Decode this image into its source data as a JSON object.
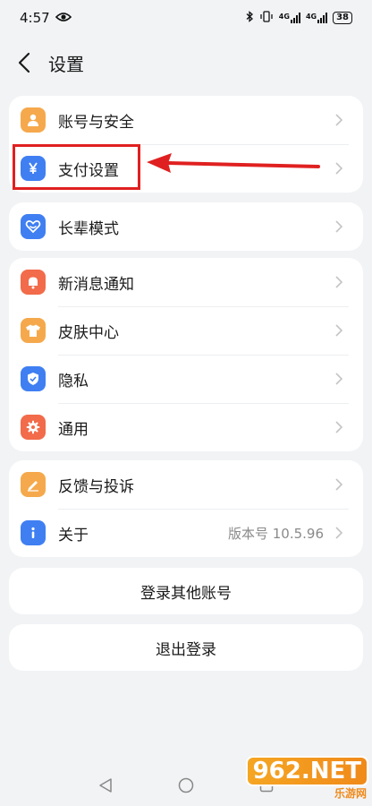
{
  "status": {
    "time": "4:57",
    "battery": "38",
    "net1": "4G",
    "net2": "4G"
  },
  "header": {
    "title": "设置"
  },
  "groups": {
    "g1": [
      {
        "label": "账号与安全"
      },
      {
        "label": "支付设置"
      }
    ],
    "g2": [
      {
        "label": "长辈模式"
      }
    ],
    "g3": [
      {
        "label": "新消息通知"
      },
      {
        "label": "皮肤中心"
      },
      {
        "label": "隐私"
      },
      {
        "label": "通用"
      }
    ],
    "g4": [
      {
        "label": "反馈与投诉"
      },
      {
        "label": "关于",
        "value": "版本号 10.5.96"
      }
    ]
  },
  "actions": {
    "switch_account": "登录其他账号",
    "logout": "退出登录"
  },
  "watermark": {
    "main": "962.NET",
    "sub": "乐游网"
  },
  "colors": {
    "accent_red": "#e02020",
    "highlight_target": "支付设置"
  }
}
